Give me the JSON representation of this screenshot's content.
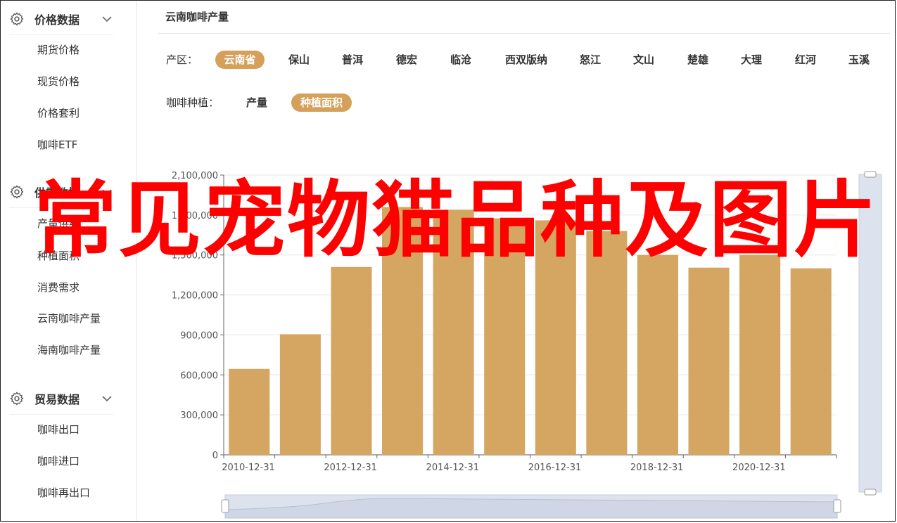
{
  "colors": {
    "accent": "#d4a05a",
    "bar": "#d4a662",
    "overlay_text": "#ff0000",
    "zoom_bg": "#dde3ee"
  },
  "sidebar": {
    "groups": [
      {
        "title": "价格数据",
        "icon": "gear-icon",
        "items": [
          "期货价格",
          "现货价格",
          "价格套利",
          "咖啡ETF"
        ]
      },
      {
        "title": "供需数据",
        "icon": "gear-icon",
        "items": [
          "产量供给",
          "种植面积",
          "消费需求",
          "云南咖啡产量",
          "海南咖啡产量"
        ]
      },
      {
        "title": "贸易数据",
        "icon": "gear-icon",
        "items": [
          "咖啡出口",
          "咖啡进口",
          "咖啡再出口"
        ]
      }
    ]
  },
  "main": {
    "title": "云南咖啡产量",
    "region_label": "产区：",
    "regions": [
      "云南省",
      "保山",
      "普洱",
      "德宏",
      "临沧",
      "西双版纳",
      "怒江",
      "文山",
      "楚雄",
      "大理",
      "红河",
      "玉溪"
    ],
    "region_selected": "云南省",
    "type_label": "咖啡种植：",
    "types": [
      "产量",
      "种植面积"
    ],
    "type_selected": "种植面积"
  },
  "overlay": {
    "text": "常见宠物猫品种及图片"
  },
  "chart_data": {
    "type": "bar",
    "categories": [
      "2010-12-31",
      "2011-12-31",
      "2012-12-31",
      "2013-12-31",
      "2014-12-31",
      "2015-12-31",
      "2016-12-31",
      "2017-12-31",
      "2018-12-31",
      "2019-12-31",
      "2020-12-31",
      "2021-12-31"
    ],
    "values": [
      645000,
      905000,
      1410000,
      1860000,
      1840000,
      1775000,
      1760000,
      1680000,
      1500000,
      1405000,
      1500000,
      1400000
    ],
    "x_tick_labels": [
      "2010-12-31",
      "2012-12-31",
      "2014-12-31",
      "2016-12-31",
      "2018-12-31",
      "2020-12-31"
    ],
    "y_tick_labels": [
      "0",
      "300,000",
      "600,000",
      "900,000",
      "1,200,000",
      "1,500,000",
      "1,800,000",
      "2,100,000"
    ],
    "ylim": [
      0,
      2100000
    ],
    "grid": true,
    "title": "",
    "xlabel": "",
    "ylabel": "",
    "legend": "none",
    "vertical_zoom_slider": true,
    "horizontal_zoom_slider": true
  }
}
